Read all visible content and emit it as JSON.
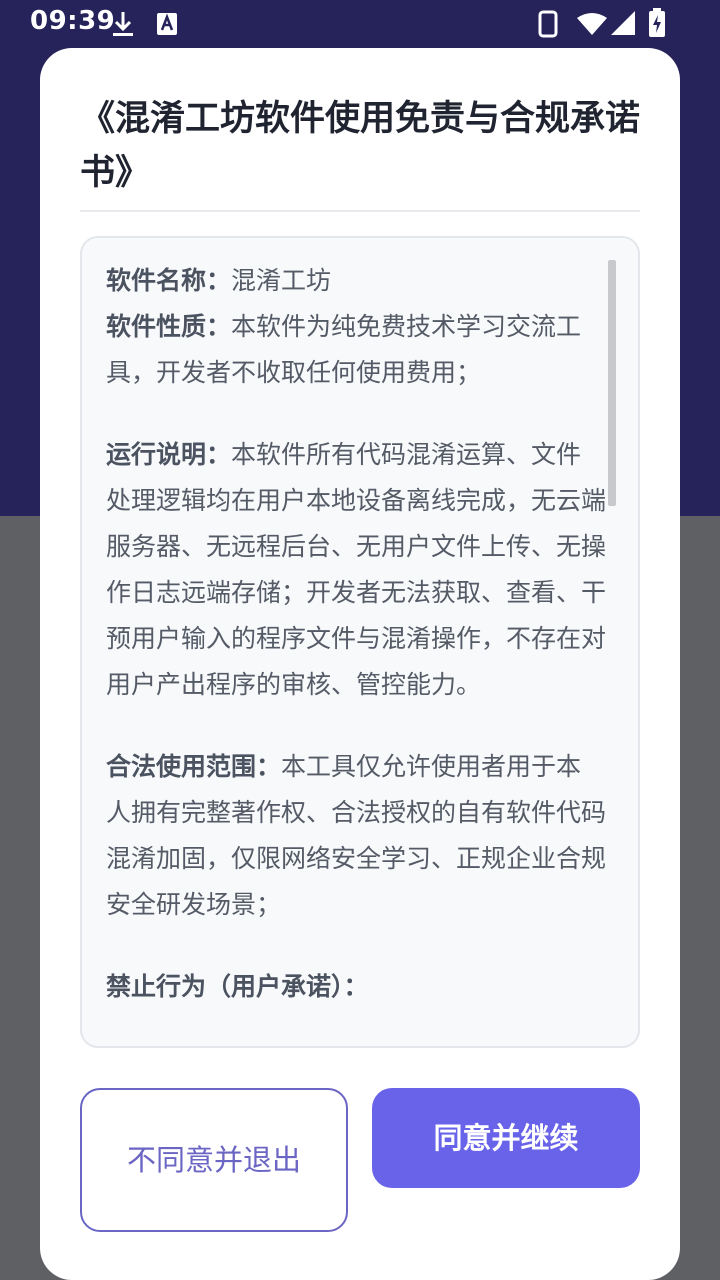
{
  "statusbar": {
    "time": "09:39"
  },
  "dialog": {
    "title": "《混淆工坊软件使用免责与合规承诺书》",
    "sections": [
      {
        "label": "软件名称：",
        "text": "混淆工坊"
      },
      {
        "label": "软件性质：",
        "text": "本软件为纯免费技术学习交流工具，开发者不收取任何使用费用；"
      },
      {
        "label": "运行说明：",
        "text": "本软件所有代码混淆运算、文件处理逻辑均在用户本地设备离线完成，无云端服务器、无远程后台、无用户文件上传、无操作日志远端存储；开发者无法获取、查看、干预用户输入的程序文件与混淆操作，不存在对用户产出程序的审核、管控能力。"
      },
      {
        "label": "合法使用范围：",
        "text": "本工具仅允许使用者用于本人拥有完整著作权、合法授权的自有软件代码混淆加固，仅限网络安全学习、正规企业合规安全研发场景；"
      },
      {
        "label": "禁止行为（用户承诺）：",
        "text": ""
      }
    ],
    "decline_label": "不同意并退出",
    "agree_label": "同意并继续"
  },
  "colors": {
    "accent": "#6863e8",
    "decline_border": "#6b65c4",
    "header_bg": "#26235b",
    "scrim": "#5f6063"
  }
}
